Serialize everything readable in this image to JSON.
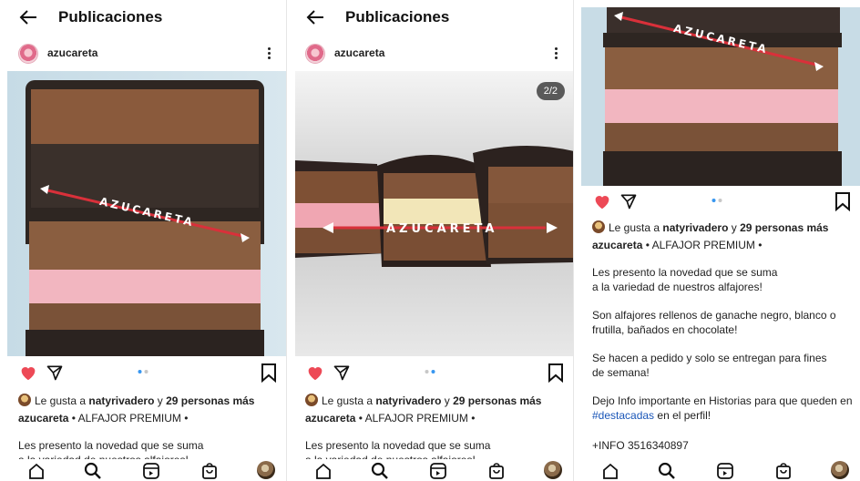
{
  "header": {
    "title": "Publicaciones",
    "back_icon": "arrow-left-icon"
  },
  "post": {
    "username": "azucareta",
    "watermark": "AZUCARETA",
    "carousel_counter": "2/2",
    "like_prefix": "Le gusta a ",
    "liker": "natyrivadero",
    "like_mid": " y ",
    "like_count": "29 personas más",
    "caption_title": " • ALFAJOR PREMIUM •",
    "caption_line1": "Les presento la novedad que se suma",
    "caption_line2": "a la variedad de nuestros alfajores!",
    "para2": "Son alfajores rellenos de ganache negro, blanco o frutilla, bañados en chocolate!",
    "para3": "Se hacen a pedido y solo se entregan para fines de semana!",
    "para4_text": "Dejo Info importante en Historias para que queden en ",
    "para4_hashtag": "#destacadas",
    "para4_end": " en el perfil!",
    "info": "+INFO 3516340897"
  },
  "colors": {
    "heart": "#ed4956",
    "dot_active": "#3897f0",
    "dot_inactive": "#c7c7c7",
    "hashtag": "#1a56b8"
  },
  "nav": {
    "icons": [
      "home-icon",
      "search-icon",
      "reels-icon",
      "shop-icon",
      "profile-avatar"
    ]
  }
}
